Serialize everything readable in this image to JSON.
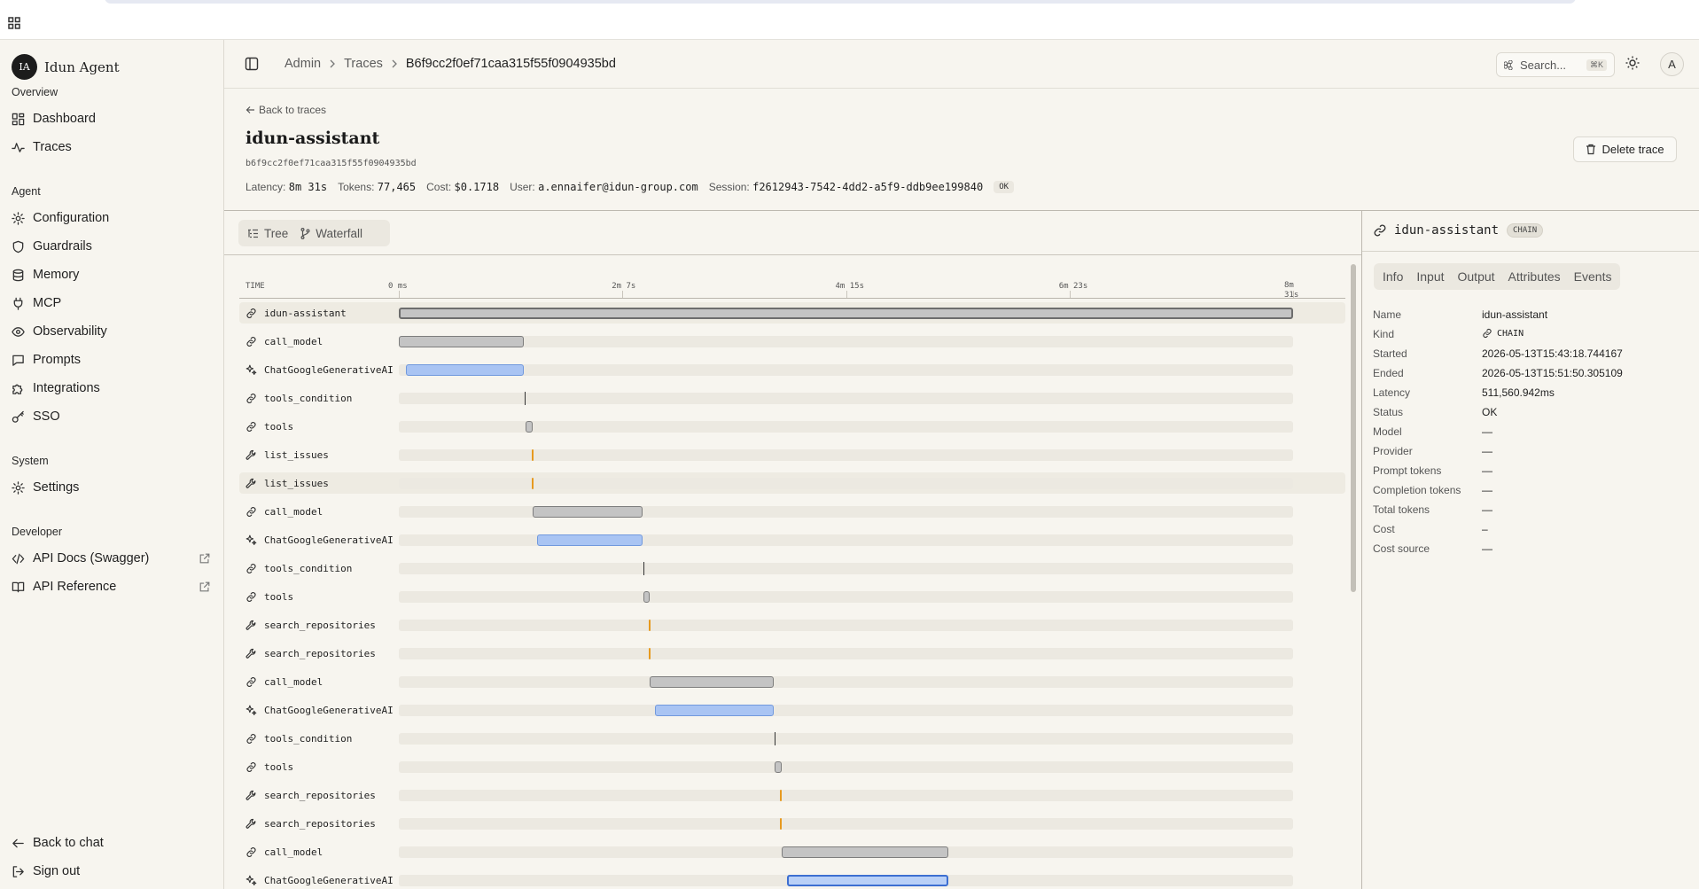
{
  "app": {
    "name": "Idun Agent",
    "logo_text": "IA"
  },
  "sidebar": {
    "sections": [
      {
        "title": "Overview",
        "items": [
          {
            "label": "Dashboard",
            "icon": "dashboard-icon"
          },
          {
            "label": "Traces",
            "icon": "activity-icon"
          }
        ]
      },
      {
        "title": "Agent",
        "items": [
          {
            "label": "Configuration",
            "icon": "gear-icon"
          },
          {
            "label": "Guardrails",
            "icon": "shield-icon"
          },
          {
            "label": "Memory",
            "icon": "database-icon"
          },
          {
            "label": "MCP",
            "icon": "plug-icon"
          },
          {
            "label": "Observability",
            "icon": "eye-icon"
          },
          {
            "label": "Prompts",
            "icon": "chat-icon"
          },
          {
            "label": "Integrations",
            "icon": "puzzle-icon"
          },
          {
            "label": "SSO",
            "icon": "key-icon"
          }
        ]
      },
      {
        "title": "System",
        "items": [
          {
            "label": "Settings",
            "icon": "gear-icon"
          }
        ]
      },
      {
        "title": "Developer",
        "items": [
          {
            "label": "API Docs (Swagger)",
            "icon": "code-icon"
          },
          {
            "label": "API Reference",
            "icon": "book-icon"
          }
        ]
      }
    ],
    "footer": [
      {
        "label": "Back to chat",
        "icon": "arrow-left-icon"
      },
      {
        "label": "Sign out",
        "icon": "logout-icon"
      }
    ]
  },
  "header": {
    "breadcrumbs": [
      "Admin",
      "Traces",
      "B6f9cc2f0ef71caa315f55f0904935bd"
    ],
    "search_label": "Search...",
    "search_shortcut": "⌘K",
    "avatar_letter": "A"
  },
  "trace": {
    "back_label": "Back to traces",
    "title": "idun-assistant",
    "id": "b6f9cc2f0ef71caa315f55f0904935bd",
    "latency_label": "Latency:",
    "latency": "8m 31s",
    "tokens_label": "Tokens:",
    "tokens": "77,465",
    "cost_label": "Cost:",
    "cost": "$0.1718",
    "user_label": "User:",
    "user": "a.ennaifer@idun-group.com",
    "session_label": "Session:",
    "session": "f2612943-7542-4dd2-a5f9-ddb9ee199840",
    "status": "OK",
    "delete_label": "Delete trace"
  },
  "views": {
    "tree": "Tree",
    "waterfall": "Waterfall"
  },
  "timeline": {
    "time_header": "TIME",
    "ticks": [
      "0 ms",
      "2m 7s",
      "4m 15s",
      "6m 23s",
      "8m 31s"
    ],
    "total_seconds": 511.56,
    "spans": [
      {
        "name": "idun-assistant",
        "type": "chain",
        "start": 0,
        "end": 511.56,
        "root": true
      },
      {
        "name": "call_model",
        "type": "chain",
        "start": 0,
        "end": 71.6
      },
      {
        "name": "ChatGoogleGenerativeAI",
        "type": "llm",
        "start": 4.3,
        "end": 71.6
      },
      {
        "name": "tools_condition",
        "type": "mark",
        "start": 72.1,
        "end": 72.1
      },
      {
        "name": "tools",
        "type": "chain",
        "start": 72.6,
        "end": 76.6
      },
      {
        "name": "list_issues",
        "type": "tool",
        "start": 75.8,
        "end": 76.6
      },
      {
        "name": "list_issues",
        "type": "tool",
        "start": 75.8,
        "end": 76.6,
        "highlight": true
      },
      {
        "name": "call_model",
        "type": "chain",
        "start": 76.6,
        "end": 139.3
      },
      {
        "name": "ChatGoogleGenerativeAI",
        "type": "llm",
        "start": 79.1,
        "end": 139.3
      },
      {
        "name": "tools_condition",
        "type": "mark",
        "start": 139.8,
        "end": 139.8
      },
      {
        "name": "tools",
        "type": "chain",
        "start": 139.8,
        "end": 143.7
      },
      {
        "name": "search_repositories",
        "type": "tool",
        "start": 142.9,
        "end": 143.7
      },
      {
        "name": "search_repositories",
        "type": "tool",
        "start": 142.9,
        "end": 143.7
      },
      {
        "name": "call_model",
        "type": "chain",
        "start": 143.7,
        "end": 214.5
      },
      {
        "name": "ChatGoogleGenerativeAI",
        "type": "llm",
        "start": 146.6,
        "end": 214.5
      },
      {
        "name": "tools_condition",
        "type": "mark",
        "start": 214.8,
        "end": 214.8
      },
      {
        "name": "tools",
        "type": "chain",
        "start": 214.8,
        "end": 218.9
      },
      {
        "name": "search_repositories",
        "type": "tool",
        "start": 217.9,
        "end": 218.9
      },
      {
        "name": "search_repositories",
        "type": "tool",
        "start": 217.9,
        "end": 218.9
      },
      {
        "name": "call_model",
        "type": "chain",
        "start": 218.9,
        "end": 314.3
      },
      {
        "name": "ChatGoogleGenerativeAI",
        "type": "llm",
        "start": 221.9,
        "end": 314.3,
        "selected": true
      }
    ]
  },
  "details": {
    "title": "idun-assistant",
    "kind_badge": "CHAIN",
    "tabs": [
      "Info",
      "Input",
      "Output",
      "Attributes",
      "Events"
    ],
    "fields": [
      {
        "key": "Name",
        "value": "idun-assistant"
      },
      {
        "key": "Kind",
        "value": "CHAIN",
        "icon": "link-icon",
        "mono": true
      },
      {
        "key": "Started",
        "value": "2026-05-13T15:43:18.744167"
      },
      {
        "key": "Ended",
        "value": "2026-05-13T15:51:50.305109"
      },
      {
        "key": "Latency",
        "value": "511,560.942ms"
      },
      {
        "key": "Status",
        "value": "OK"
      },
      {
        "key": "Model",
        "value": "—"
      },
      {
        "key": "Provider",
        "value": "—"
      },
      {
        "key": "Prompt tokens",
        "value": "—"
      },
      {
        "key": "Completion tokens",
        "value": "—"
      },
      {
        "key": "Total tokens",
        "value": "—"
      },
      {
        "key": "Cost",
        "value": "–"
      },
      {
        "key": "Cost source",
        "value": "—"
      }
    ]
  }
}
